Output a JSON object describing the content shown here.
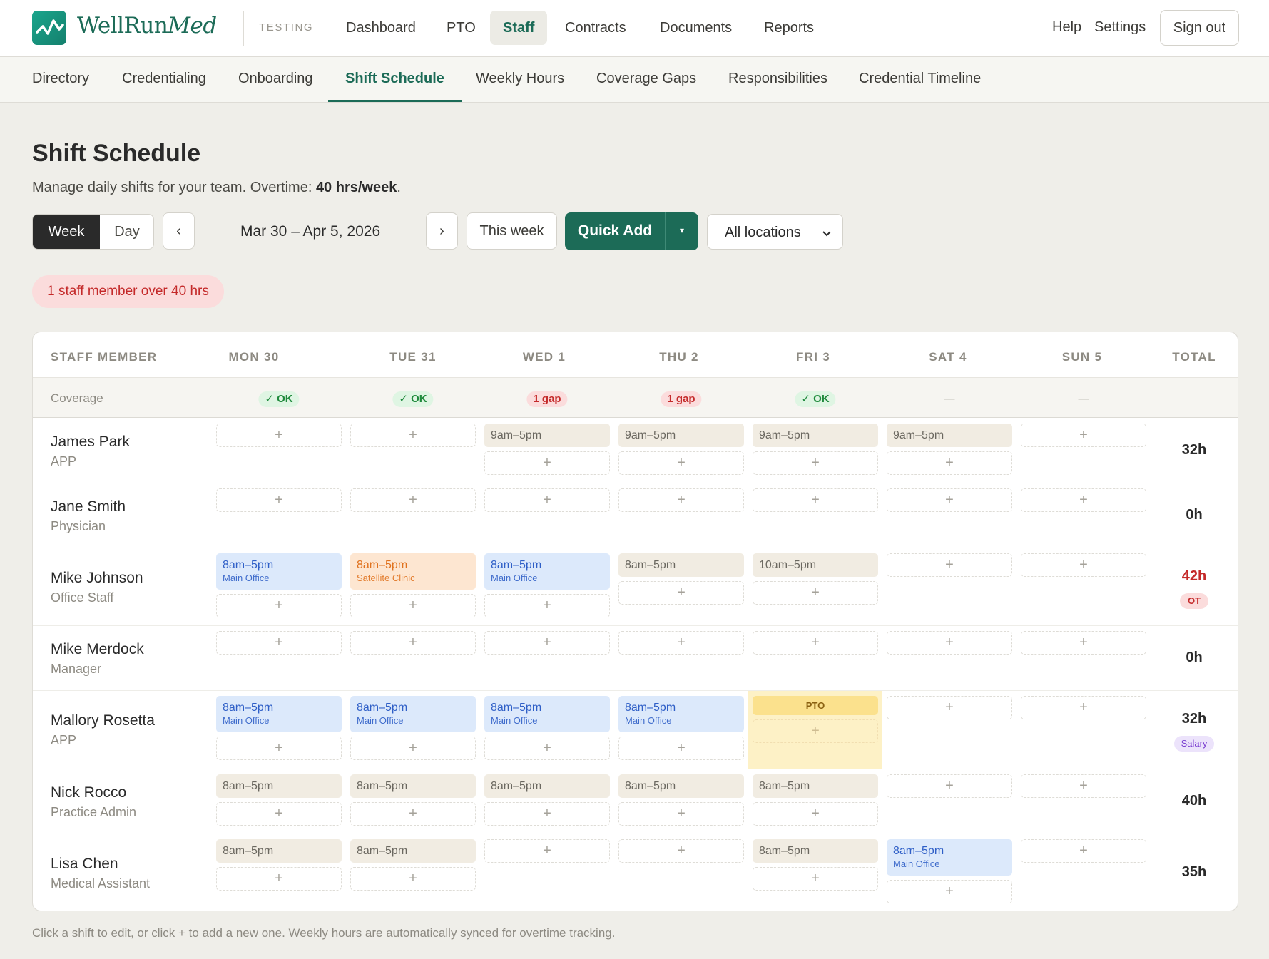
{
  "brand": {
    "name_plain": "WellRun",
    "name_italic": "Med",
    "env_tag": "TESTING"
  },
  "main_nav": [
    "Dashboard",
    "PTO",
    "Staff",
    "Contracts",
    "Documents",
    "Reports"
  ],
  "main_nav_active": "Staff",
  "top_right": {
    "help": "Help",
    "settings": "Settings",
    "sign_out": "Sign out"
  },
  "sub_nav": [
    "Directory",
    "Credentialing",
    "Onboarding",
    "Shift Schedule",
    "Weekly Hours",
    "Coverage Gaps",
    "Responsibilities",
    "Credential Timeline"
  ],
  "sub_nav_active": "Shift Schedule",
  "page": {
    "title": "Shift Schedule",
    "subtitle_prefix": "Manage daily shifts for your team. Overtime: ",
    "subtitle_bold": "40 hrs/week",
    "subtitle_suffix": "."
  },
  "toolbar": {
    "view_week": "Week",
    "view_day": "Day",
    "prev": "‹",
    "next": "›",
    "date_range": "Mar 30 – Apr 5, 2026",
    "this_week": "This week",
    "quick_add": "Quick Add",
    "quick_add_caret": "▾",
    "location_select": "All locations"
  },
  "alert": "1 staff member over 40 hrs",
  "table": {
    "header_staff": "STAFF MEMBER",
    "header_total": "TOTAL",
    "days": [
      "MON 30",
      "TUE 31",
      "WED 1",
      "THU 2",
      "FRI 3",
      "SAT 4",
      "SUN 5"
    ],
    "coverage_label": "Coverage",
    "coverage": [
      {
        "text": "✓ OK",
        "status": "ok"
      },
      {
        "text": "✓ OK",
        "status": "ok"
      },
      {
        "text": "1 gap",
        "status": "gap"
      },
      {
        "text": "1 gap",
        "status": "gap"
      },
      {
        "text": "✓ OK",
        "status": "ok"
      },
      {
        "text": "—",
        "status": "none"
      },
      {
        "text": "—",
        "status": "none"
      }
    ],
    "add_symbol": "+",
    "pto_label": "PTO",
    "staff": [
      {
        "name": "James Park",
        "role": "APP",
        "total": "32h",
        "tag": null,
        "days": [
          [],
          [],
          [
            {
              "time": "9am–5pm"
            }
          ],
          [
            {
              "time": "9am–5pm"
            }
          ],
          [
            {
              "time": "9am–5pm"
            }
          ],
          [
            {
              "time": "9am–5pm"
            }
          ],
          []
        ]
      },
      {
        "name": "Jane Smith",
        "role": "Physician",
        "total": "0h",
        "tag": null,
        "days": [
          [],
          [],
          [],
          [],
          [],
          [],
          []
        ]
      },
      {
        "name": "Mike Johnson",
        "role": "Office Staff",
        "total": "42h",
        "overtime": true,
        "tag": "OT",
        "days": [
          [
            {
              "time": "8am–5pm",
              "location": "Main Office",
              "color": "blue"
            }
          ],
          [
            {
              "time": "8am–5pm",
              "location": "Satellite Clinic",
              "color": "orange"
            }
          ],
          [
            {
              "time": "8am–5pm",
              "location": "Main Office",
              "color": "blue"
            }
          ],
          [
            {
              "time": "8am–5pm"
            }
          ],
          [
            {
              "time": "10am–5pm"
            }
          ],
          [],
          []
        ]
      },
      {
        "name": "Mike Merdock",
        "role": "Manager",
        "total": "0h",
        "tag": null,
        "days": [
          [],
          [],
          [],
          [],
          [],
          [],
          []
        ]
      },
      {
        "name": "Mallory Rosetta",
        "role": "APP",
        "total": "32h",
        "tag": "Salary",
        "days": [
          [
            {
              "time": "8am–5pm",
              "location": "Main Office",
              "color": "blue"
            }
          ],
          [
            {
              "time": "8am–5pm",
              "location": "Main Office",
              "color": "blue"
            }
          ],
          [
            {
              "time": "8am–5pm",
              "location": "Main Office",
              "color": "blue"
            }
          ],
          [
            {
              "time": "8am–5pm",
              "location": "Main Office",
              "color": "blue"
            }
          ],
          "PTO",
          [],
          []
        ]
      },
      {
        "name": "Nick Rocco",
        "role": "Practice Admin",
        "total": "40h",
        "tag": null,
        "days": [
          [
            {
              "time": "8am–5pm"
            }
          ],
          [
            {
              "time": "8am–5pm"
            }
          ],
          [
            {
              "time": "8am–5pm"
            }
          ],
          [
            {
              "time": "8am–5pm"
            }
          ],
          [
            {
              "time": "8am–5pm"
            }
          ],
          [],
          []
        ]
      },
      {
        "name": "Lisa Chen",
        "role": "Medical Assistant",
        "total": "35h",
        "tag": null,
        "days": [
          [
            {
              "time": "8am–5pm"
            }
          ],
          [
            {
              "time": "8am–5pm"
            }
          ],
          [],
          [],
          [
            {
              "time": "8am–5pm"
            }
          ],
          [
            {
              "time": "8am–5pm",
              "location": "Main Office",
              "color": "blue"
            }
          ],
          []
        ]
      }
    ]
  },
  "footer_note": "Click a shift to edit, or click + to add a new one. Weekly hours are automatically synced for overtime tracking.",
  "colors": {
    "brand_green": "#1c6b57",
    "shift_blue": "#dce9fb",
    "shift_orange": "#fde6d1",
    "shift_plain": "#f1ece2",
    "pto_yellow": "#fdf1c6",
    "overtime_red": "#c42a2a"
  },
  "icons": {
    "logo": "heartbeat-chart-icon",
    "select_caret": "chevron-down-icon"
  }
}
